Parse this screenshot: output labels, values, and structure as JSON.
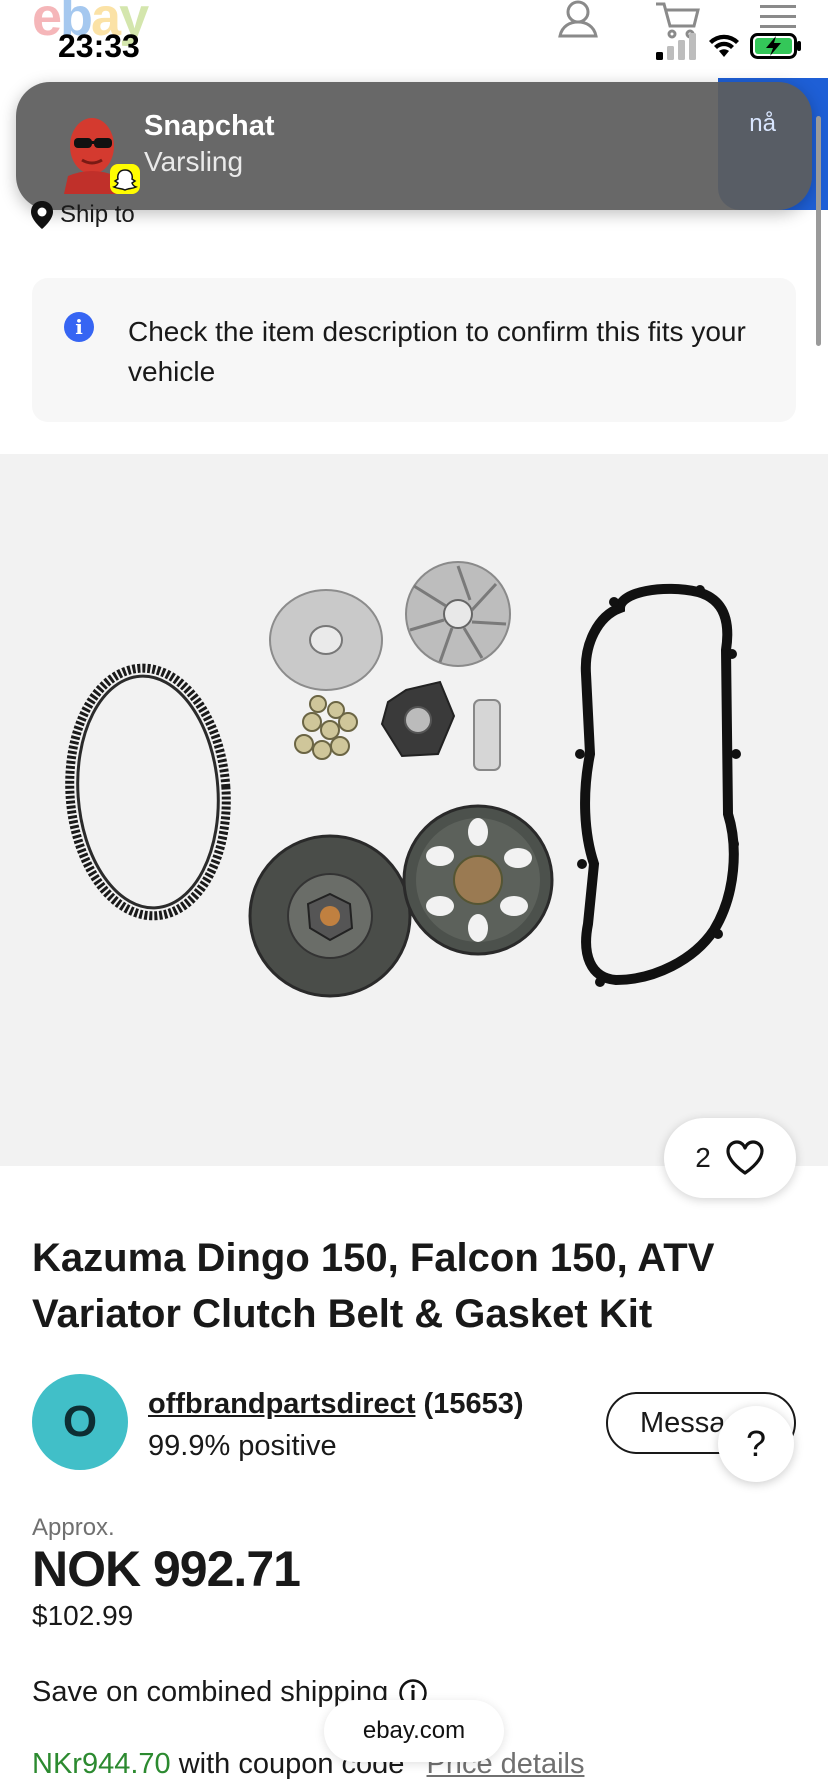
{
  "status_bar": {
    "time": "23:33",
    "battery": "charging"
  },
  "header": {
    "logo_letters": [
      "e",
      "b",
      "a",
      "y"
    ],
    "icons": [
      "account-icon",
      "cart-icon",
      "menu-icon"
    ]
  },
  "notification": {
    "app": "Snapchat",
    "message": "Varsling",
    "time": "nå"
  },
  "ship_to": {
    "label": "Ship to"
  },
  "info": {
    "text": "Check the item description to confirm this fits your vehicle"
  },
  "product": {
    "favorites_count": "2",
    "title": "Kazuma Dingo 150, Falcon 150, ATV Variator Clutch Belt & Gasket Kit"
  },
  "seller": {
    "initial": "O",
    "name": "offbrandpartsdirect",
    "score": "(15653)",
    "feedback": "99.9% positive",
    "message_button": "Message"
  },
  "help_button": "?",
  "pricing": {
    "approx_label": "Approx.",
    "price_nok": "NOK 992.71",
    "price_usd": "$102.99",
    "combined_shipping": "Save on combined shipping",
    "coupon_price": "NKr944.70",
    "coupon_text": "with coupon code",
    "price_details": "Price details"
  },
  "browser": {
    "url": "ebay.com"
  },
  "colors": {
    "ebay_red": "#e53238",
    "ebay_blue": "#0064d2",
    "ebay_yellow": "#f5af02",
    "ebay_green": "#86b817",
    "info_blue": "#3665f3",
    "coupon_green": "#2c8a30",
    "avatar_teal": "#41bfc8"
  }
}
